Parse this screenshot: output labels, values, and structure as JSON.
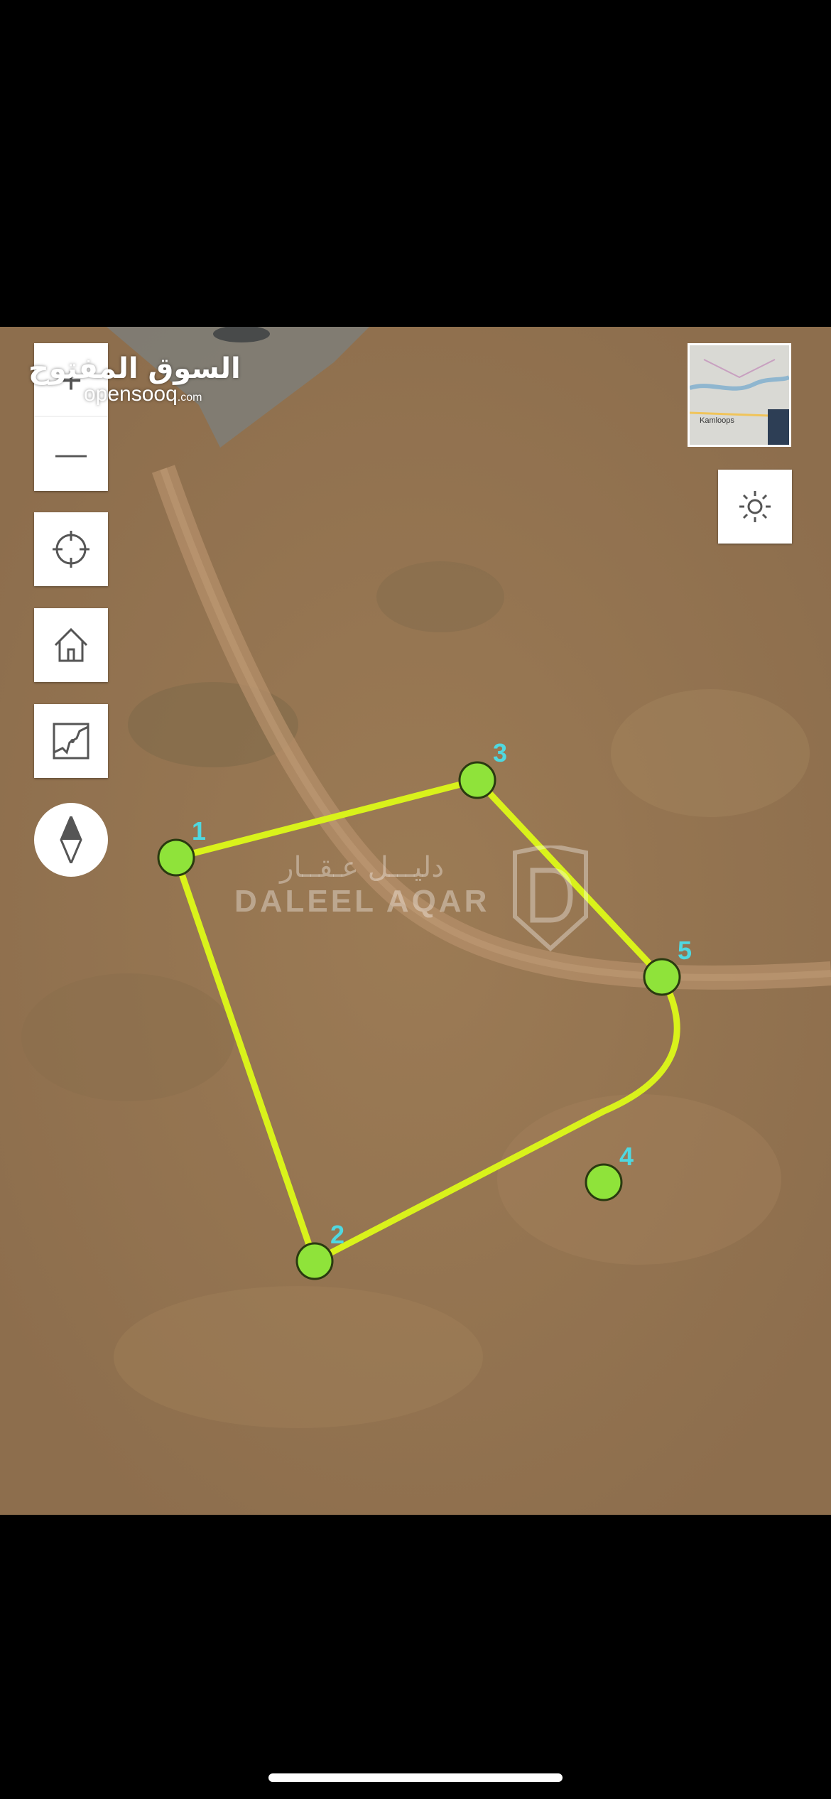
{
  "brand": {
    "arabic": "السوق المفتوح",
    "latin": "opensooq",
    "latin_suffix": ".com"
  },
  "watermark": {
    "arabic": "دليـــل عـقــار",
    "latin": "DALEEL AQAR"
  },
  "minimap": {
    "label": "Kamloops"
  },
  "controls": {
    "zoom_in": "+",
    "zoom_out": "—",
    "locate": "locate-icon",
    "home": "home-icon",
    "map_layers": "map-layers-icon",
    "compass": "compass-icon",
    "brightness": "sun-icon"
  },
  "parcel": {
    "line_color": "#d9f21b",
    "vertex_color": "#8fe33a",
    "label_color": "#4fd8e0",
    "vertices": [
      {
        "label": "1"
      },
      {
        "label": "2"
      },
      {
        "label": "3"
      },
      {
        "label": "4"
      },
      {
        "label": "5"
      }
    ]
  },
  "colors": {
    "terrain": "#9a7a54",
    "road": "#b08b66",
    "bezel": "#000000"
  }
}
